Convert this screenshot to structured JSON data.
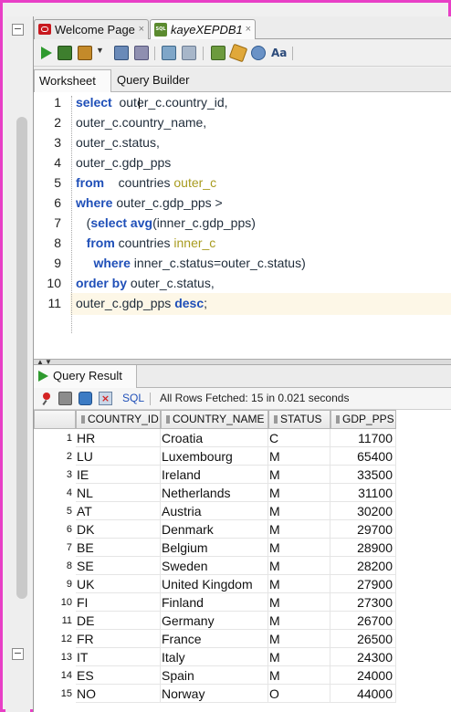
{
  "tabs": [
    {
      "label": "Welcome Page",
      "icon": "oracle-icon",
      "close": "×"
    },
    {
      "label": "kayeXEPDB1",
      "icon": "sql-db-icon",
      "close": "×"
    }
  ],
  "sub_tabs": {
    "worksheet": "Worksheet",
    "query_builder": "Query Builder"
  },
  "editor": {
    "line_numbers": [
      "1",
      "2",
      "3",
      "4",
      "5",
      "6",
      "7",
      "8",
      "9",
      "10",
      "11"
    ],
    "lines": [
      [
        {
          "t": "select",
          "c": "kw"
        },
        {
          "t": "  outer_c.country_id,"
        }
      ],
      [
        {
          "t": "outer_c.country_name,"
        }
      ],
      [
        {
          "t": "outer_c.status,"
        }
      ],
      [
        {
          "t": "outer_c.gdp_pps"
        }
      ],
      [
        {
          "t": "from",
          "c": "kw"
        },
        {
          "t": "    countries "
        },
        {
          "t": "outer_c",
          "c": "alias"
        }
      ],
      [
        {
          "t": "where",
          "c": "kw"
        },
        {
          "t": " outer_c.gdp_pps >"
        }
      ],
      [
        {
          "t": "   ("
        },
        {
          "t": "select avg",
          "c": "kw"
        },
        {
          "t": "(inner_c.gdp_pps)"
        }
      ],
      [
        {
          "t": "   "
        },
        {
          "t": "from",
          "c": "kw"
        },
        {
          "t": " countries "
        },
        {
          "t": "inner_c",
          "c": "alias"
        }
      ],
      [
        {
          "t": "     "
        },
        {
          "t": "where",
          "c": "kw"
        },
        {
          "t": " inner_c.status=outer_c.status)"
        }
      ],
      [
        {
          "t": "order by",
          "c": "kw"
        },
        {
          "t": " outer_c.status,"
        }
      ],
      [
        {
          "t": "outer_c.gdp_pps "
        },
        {
          "t": "desc",
          "c": "kw"
        },
        {
          "t": ";"
        }
      ]
    ]
  },
  "results": {
    "tab_label": "Query Result",
    "tab_close": "×",
    "sql_label": "SQL",
    "status": "All Rows Fetched: 15 in 0.021 seconds",
    "columns": [
      "COUNTRY_ID",
      "COUNTRY_NAME",
      "STATUS",
      "GDP_PPS"
    ],
    "rows": [
      [
        "1",
        "HR",
        "Croatia",
        "C",
        "11700"
      ],
      [
        "2",
        "LU",
        "Luxembourg",
        "M",
        "65400"
      ],
      [
        "3",
        "IE",
        "Ireland",
        "M",
        "33500"
      ],
      [
        "4",
        "NL",
        "Netherlands",
        "M",
        "31100"
      ],
      [
        "5",
        "AT",
        "Austria",
        "M",
        "30200"
      ],
      [
        "6",
        "DK",
        "Denmark",
        "M",
        "29700"
      ],
      [
        "7",
        "BE",
        "Belgium",
        "M",
        "28900"
      ],
      [
        "8",
        "SE",
        "Sweden",
        "M",
        "28200"
      ],
      [
        "9",
        "UK",
        "United Kingdom",
        "M",
        "27900"
      ],
      [
        "10",
        "FI",
        "Finland",
        "M",
        "27300"
      ],
      [
        "11",
        "DE",
        "Germany",
        "M",
        "26700"
      ],
      [
        "12",
        "FR",
        "France",
        "M",
        "26500"
      ],
      [
        "13",
        "IT",
        "Italy",
        "M",
        "24300"
      ],
      [
        "14",
        "ES",
        "Spain",
        "M",
        "24000"
      ],
      [
        "15",
        "NO",
        "Norway",
        "O",
        "44000"
      ]
    ]
  },
  "gutter": {
    "top_button": "−",
    "bottom_button": "−"
  },
  "colors": {
    "frame": "#e83fc6",
    "keyword": "#1f4fb8",
    "alias": "#a89b1f",
    "run": "#2e9a2e"
  }
}
